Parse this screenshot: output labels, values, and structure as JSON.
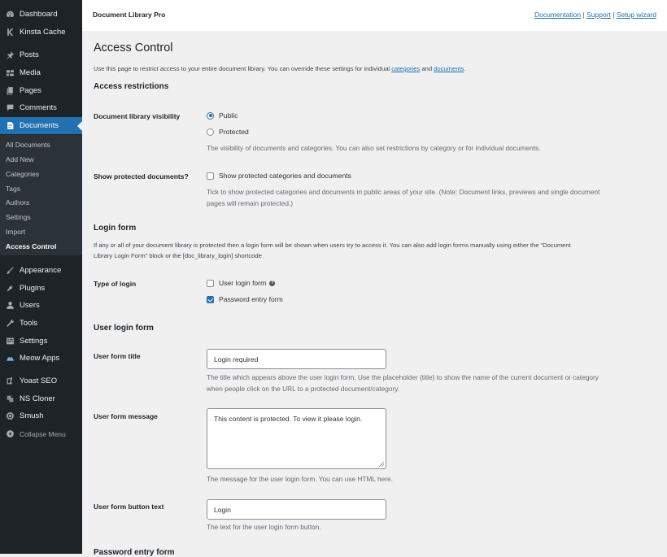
{
  "sidebar": {
    "items": [
      {
        "label": "Dashboard",
        "icon": "dashboard-icon"
      },
      {
        "label": "Kinsta Cache",
        "icon": "kinsta-icon"
      },
      {
        "label": "Posts",
        "icon": "pin-icon"
      },
      {
        "label": "Media",
        "icon": "media-icon"
      },
      {
        "label": "Pages",
        "icon": "pages-icon"
      },
      {
        "label": "Comments",
        "icon": "comments-icon"
      },
      {
        "label": "Documents",
        "icon": "document-icon"
      },
      {
        "label": "Appearance",
        "icon": "brush-icon"
      },
      {
        "label": "Plugins",
        "icon": "plug-icon"
      },
      {
        "label": "Users",
        "icon": "user-icon"
      },
      {
        "label": "Tools",
        "icon": "wrench-icon"
      },
      {
        "label": "Settings",
        "icon": "settings-icon"
      },
      {
        "label": "Meow Apps",
        "icon": "meow-icon"
      },
      {
        "label": "Yoast SEO",
        "icon": "yoast-icon"
      },
      {
        "label": "NS Cloner",
        "icon": "cloner-icon"
      },
      {
        "label": "Smush",
        "icon": "smush-icon"
      },
      {
        "label": "Collapse Menu",
        "icon": "collapse-icon"
      }
    ],
    "submenu": [
      "All Documents",
      "Add New",
      "Categories",
      "Tags",
      "Authors",
      "Settings",
      "Import",
      "Access Control"
    ]
  },
  "header": {
    "title": "Document Library Pro",
    "links": [
      "Documentation",
      "Support",
      "Setup wizard"
    ],
    "separator": "|"
  },
  "page": {
    "title": "Access Control",
    "intro_prefix": "Use this page to restrict access to your entire document library. You can override these settings for individual ",
    "intro_link1": "categories",
    "intro_mid": " and ",
    "intro_link2": "documents",
    "intro_suffix": "."
  },
  "access": {
    "heading": "Access restrictions",
    "visibility_label": "Document library visibility",
    "visibility_options": [
      "Public",
      "Protected"
    ],
    "visibility_selected": "Public",
    "visibility_desc": "The visibility of documents and categories. You can also set restrictions by category or for individual documents.",
    "show_protected_label": "Show protected documents?",
    "show_protected_option": "Show protected categories and documents",
    "show_protected_checked": false,
    "show_protected_desc1": "Tick to show protected categories and documents in public areas of your site. (Note: Document links, previews and single document",
    "show_protected_desc2": "pages will remain protected.)"
  },
  "login_form": {
    "heading": "Login form",
    "para1": "If any or all of your document library is protected then a login form will be shown when users try to access it. You can also add login forms manually using either the “Document",
    "para2": "Library Login Form” block or the [doc_library_login] shortcode.",
    "type_label": "Type of login",
    "type_options": [
      {
        "label": "User login form",
        "checked": false
      },
      {
        "label": "Password entry form",
        "checked": true
      }
    ],
    "help_glyph": "?"
  },
  "user_login_form": {
    "heading": "User login form",
    "title_label": "User form title",
    "title_value": "Login required",
    "title_desc1": "The title which appears above the user login form. Use the placeholder {title} to show the name of the current document or category",
    "title_desc2": "when people click on the URL to a protected document/category.",
    "message_label": "User form message",
    "message_value": "This content is protected. To view it please login.",
    "message_desc": "The message for the user login form. You can use HTML here.",
    "button_label": "User form button text",
    "button_value": "Login",
    "button_desc": "The text for the user login form button."
  },
  "password_form": {
    "heading": "Password entry form"
  },
  "colors": {
    "sidebar_bg": "#1d2327",
    "accent": "#2271b1",
    "page_bg": "#f0f0f1"
  }
}
